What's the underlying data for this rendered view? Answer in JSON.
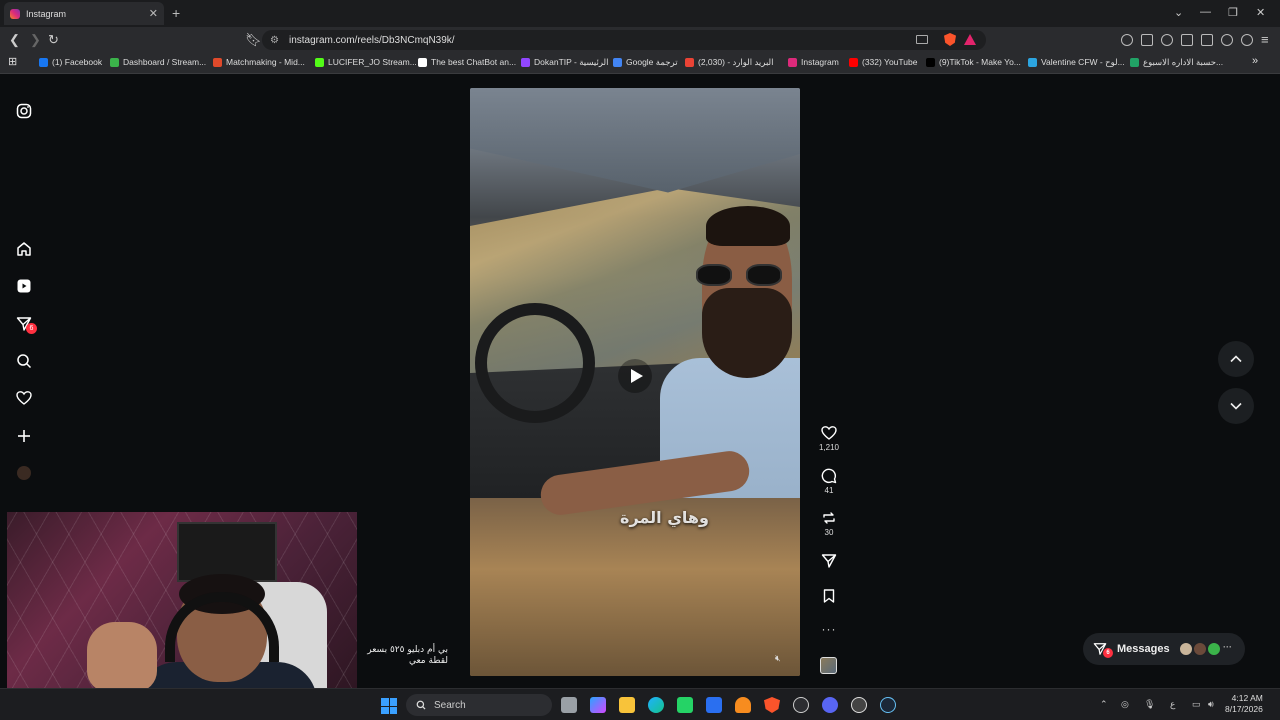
{
  "browser": {
    "tab_title": "Instagram",
    "url": "instagram.com/reels/Db3NCmqN39k/",
    "bookmarks": [
      {
        "label": "(1) Facebook",
        "color": "#1877f2"
      },
      {
        "label": "Dashboard / Stream...",
        "color": "#3bb34a"
      },
      {
        "label": "Matchmaking - Mid...",
        "color": "#e04a2b"
      },
      {
        "label": "LUCIFER_JO Stream...",
        "color": "#53fc18"
      },
      {
        "label": "The best ChatBot an...",
        "color": "#ffffff"
      },
      {
        "label": "DokanTIP - الرئيسية",
        "color": "#9146ff"
      },
      {
        "label": "Google ترجمة",
        "color": "#4285f4"
      },
      {
        "label": "البريد الوارد - (2,030)",
        "color": "#ea4335"
      },
      {
        "label": "Instagram",
        "color": "#dd2a7b"
      },
      {
        "label": "(332) YouTube",
        "color": "#ff0000"
      },
      {
        "label": "(9)TikTok - Make Yo...",
        "color": "#000000"
      },
      {
        "label": "Valentine CFW - لوح...",
        "color": "#2ca5e0"
      },
      {
        "label": "حسبة الاداره الاسبوع...",
        "color": "#21a366"
      }
    ]
  },
  "sidebar": {
    "notifications_badge": "6"
  },
  "reel": {
    "caption": "وهاي المرة",
    "likes": "1,210",
    "comments": "41",
    "reposts": "30"
  },
  "messages": {
    "label": "Messages",
    "badge": "6"
  },
  "stream_subtitle": "بي أم دبليو ٥٢٥ بسعر لقطة معي",
  "taskbar": {
    "search_placeholder": "Search",
    "time": "4:12 AM",
    "date": "8/17/2026",
    "lang": "ع"
  }
}
